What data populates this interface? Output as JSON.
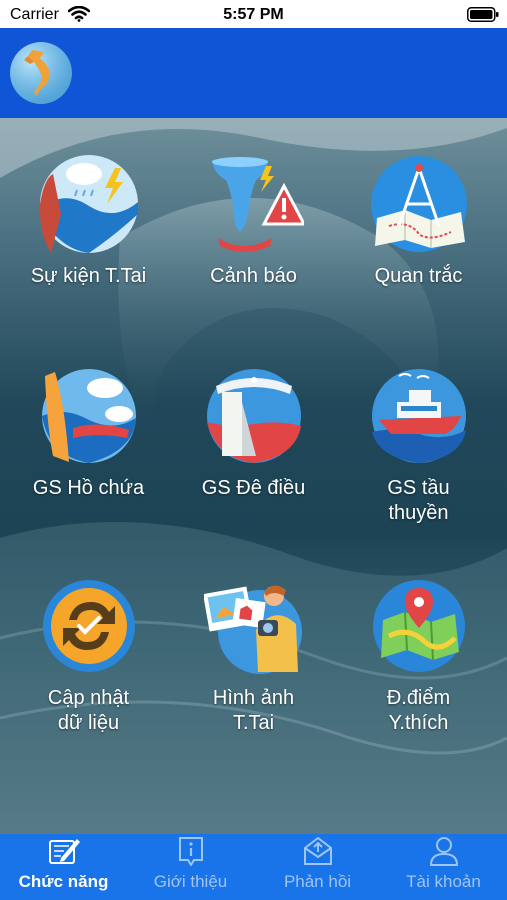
{
  "status_bar": {
    "carrier": "Carrier",
    "time": "5:57 PM"
  },
  "header": {
    "logo_icon": "vietnam-globe-icon"
  },
  "tiles": [
    {
      "label": "Sự kiện T.Tai",
      "icon": "disaster-event-icon"
    },
    {
      "label": "Cảnh báo",
      "icon": "warning-tornado-icon"
    },
    {
      "label": "Quan trắc",
      "icon": "observation-map-icon"
    },
    {
      "label": "GS Hồ chứa",
      "icon": "reservoir-icon"
    },
    {
      "label": "GS Đê điều",
      "icon": "dike-icon"
    },
    {
      "label": "GS tầu\nthuyền",
      "icon": "ship-icon"
    },
    {
      "label": "Cập nhật\ndữ liệu",
      "icon": "sync-data-icon"
    },
    {
      "label": "Hình ảnh\nT.Tai",
      "icon": "disaster-photo-icon"
    },
    {
      "label": "Đ.điểm\nY.thích",
      "icon": "favorite-location-icon"
    }
  ],
  "tabs": [
    {
      "label": "Chức năng",
      "icon": "functions-icon",
      "active": true
    },
    {
      "label": "Giới thiệu",
      "icon": "info-icon",
      "active": false
    },
    {
      "label": "Phản hồi",
      "icon": "feedback-icon",
      "active": false
    },
    {
      "label": "Tài khoản",
      "icon": "account-icon",
      "active": false
    }
  ],
  "colors": {
    "header": "#0f55d6",
    "tab_bar": "#1874e8",
    "tab_active": "#ffffff",
    "tab_inactive": "#9fc4f6"
  }
}
